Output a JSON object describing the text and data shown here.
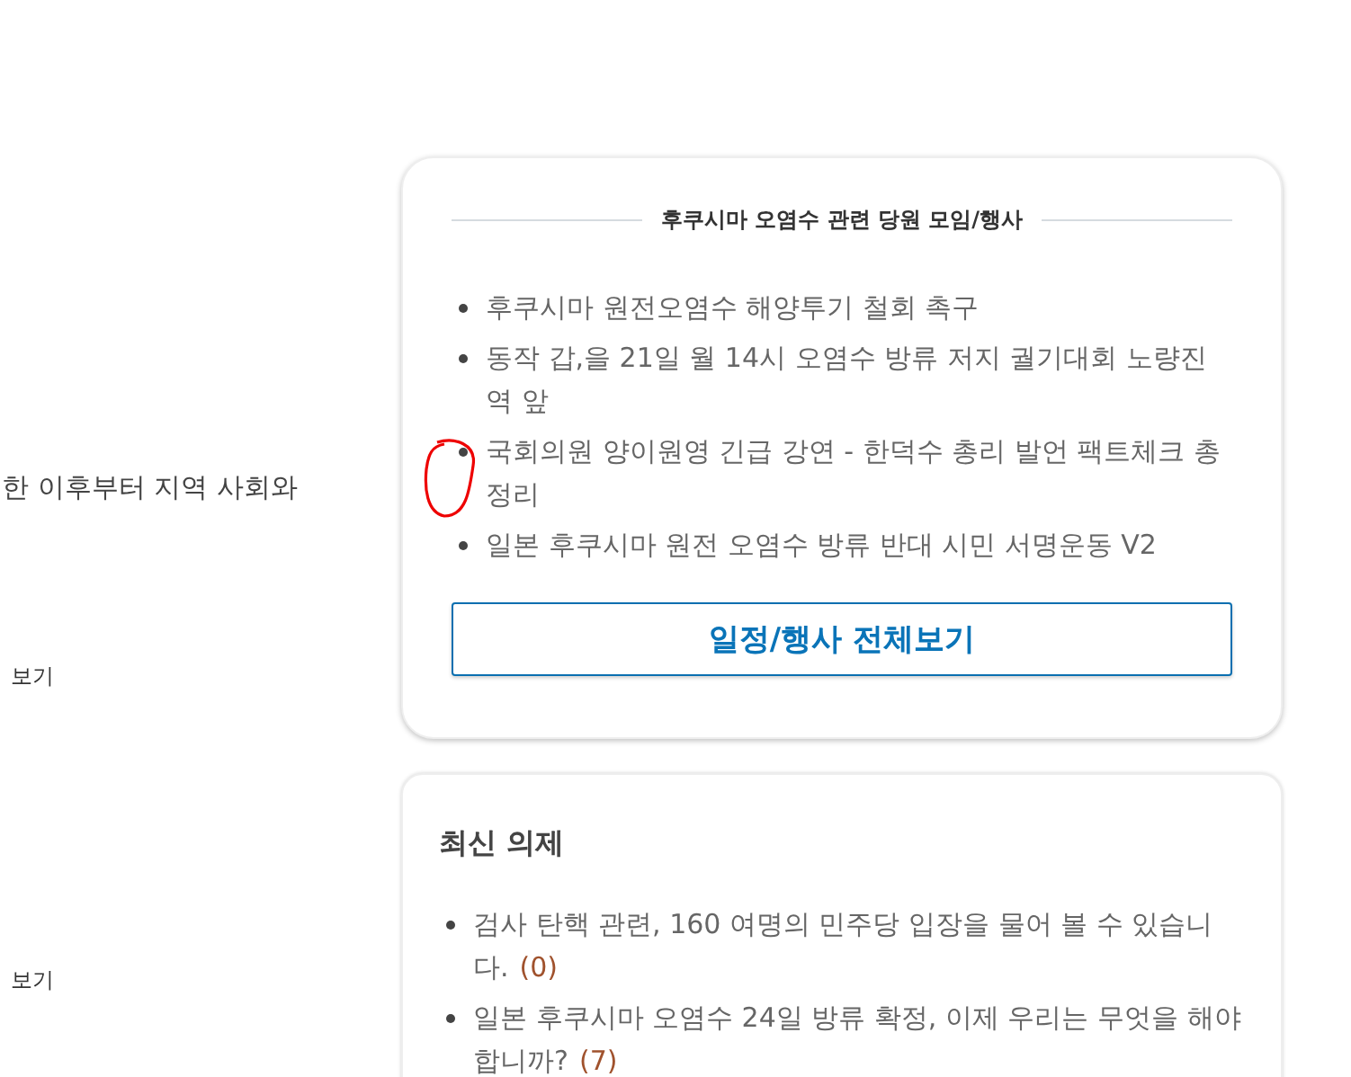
{
  "left_column": {
    "text": "한 이후부터 지역 사회와",
    "links": [
      "보기",
      "보기"
    ]
  },
  "events_card": {
    "title": "후쿠시마 오염수 관련 당원 모임/행사",
    "items": [
      "후쿠시마 원전오염수 해양투기 철회 촉구",
      "동작 갑,을 21일 월 14시 오염수 방류 저지 궐기대회 노량진역 앞",
      "국회의원 양이원영 긴급 강연 - 한덕수 총리 발언 팩트체크 총정리",
      "일본 후쿠시마 원전 오염수 방류 반대 시민 서명운동 V2"
    ],
    "button": "일정/행사 전체보기"
  },
  "agenda_card": {
    "title": "최신 의제",
    "items": [
      {
        "text": "검사 탄핵 관련, 160 여명의 민주당 입장을 물어 볼 수 있습니다.",
        "count": "(0)"
      },
      {
        "text": "일본 후쿠시마 오염수 24일 방류 확정, 이제 우리는 무엇을 해야 합니까?",
        "count": "(7)"
      }
    ]
  }
}
